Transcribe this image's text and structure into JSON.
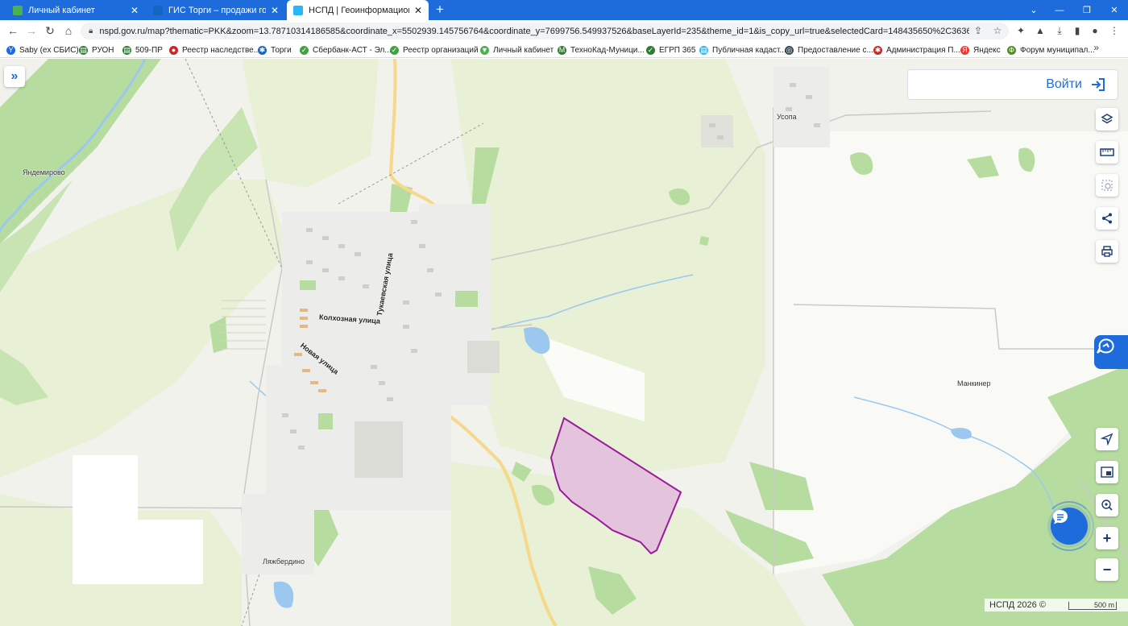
{
  "browser": {
    "tabs": [
      {
        "title": "Личный кабинет",
        "active": false,
        "favicon_color": "#4caf50"
      },
      {
        "title": "ГИС Торги – продажи государс",
        "active": false,
        "favicon_color": "#1565c0"
      },
      {
        "title": "НСПД | Геоинформационный п",
        "active": true,
        "favicon_color": "#29b6f6"
      }
    ],
    "new_tab": "+",
    "window_controls": [
      "⌄",
      "—",
      "❐",
      "✕"
    ],
    "url": "nspd.gov.ru/map?thematic=PKK&zoom=13.78710314186585&coordinate_x=5502939.145756764&coordinate_y=7699756.549937526&baseLayerId=235&theme_id=1&is_copy_url=true&selectedCard=148435650%2C36368%2C12%3A12...",
    "bookmarks": [
      {
        "label": "Saby (ex СБИС)",
        "color": "#1e6cdc",
        "glyph": "Y"
      },
      {
        "label": "РУОН",
        "color": "#2e7d32",
        "glyph": "▤"
      },
      {
        "label": "509-ПР",
        "color": "#2e7d32",
        "glyph": "▤"
      },
      {
        "label": "Реестр наследстве...",
        "color": "#c62828",
        "glyph": "●"
      },
      {
        "label": "Торги",
        "color": "#1565c0",
        "glyph": "✱"
      },
      {
        "label": "Сбербанк-АСТ - Эл...",
        "color": "#43a047",
        "glyph": "✓"
      },
      {
        "label": "Реестр организаций",
        "color": "#43a047",
        "glyph": "✓"
      },
      {
        "label": "Личный кабинет",
        "color": "#4caf50",
        "glyph": "▼"
      },
      {
        "label": "ТехноКад-Муници...",
        "color": "#2e7d32",
        "glyph": "M"
      },
      {
        "label": "ЕГРП 365",
        "color": "#2e7d32",
        "glyph": "✓"
      },
      {
        "label": "Публичная кадаст...",
        "color": "#29b6f6",
        "glyph": "▤"
      },
      {
        "label": "Предоставление с...",
        "color": "#37474f",
        "glyph": "◎"
      },
      {
        "label": "Администрация П...",
        "color": "#c62828",
        "glyph": "✱"
      },
      {
        "label": "Яндекс",
        "color": "#e53935",
        "glyph": "Я"
      },
      {
        "label": "Форум муниципал...",
        "color": "#558b2f",
        "glyph": "Ф"
      }
    ],
    "bookmarks_more": "»"
  },
  "map": {
    "login_label": "Войти",
    "expand_icon": "»",
    "place_labels": {
      "yandemirovo": "Яндемирово",
      "usopa": "Усопа",
      "mankiner": "Манкинер",
      "lyazherdino": "Ляжбердино"
    },
    "street_labels": {
      "kolkhoznaya": "Колхозная улица",
      "tuchevskaya": "Тукаевская улица",
      "novaya": "Новая улица"
    },
    "attribution": "НСПД 2026 ©",
    "scale": "500 m",
    "colors": {
      "background": "#f1f2ec",
      "forest": "#b7dca0",
      "field": "#e8f0d6",
      "parcel_fill": "#e3c4dc",
      "parcel_stroke": "#9c1a9c",
      "road_major": "#f5d88a",
      "water": "#9cc8ef",
      "accent": "#1e6cdc"
    },
    "chat_icon": "chat-bubble-icon",
    "gpt_icon": "assistant-icon"
  }
}
